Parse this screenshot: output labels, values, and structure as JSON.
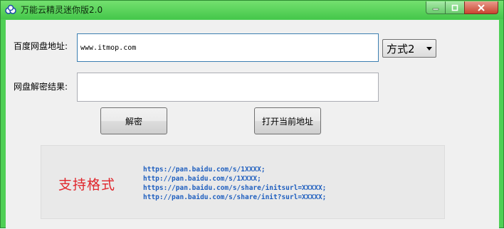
{
  "window": {
    "title": "万能云精灵迷你版2.0"
  },
  "form": {
    "pan_url_label": "百度网盘地址:",
    "pan_url_value": "www.itmop.com",
    "method_selected": "方式2",
    "result_label": "网盘解密结果:",
    "result_value": ""
  },
  "buttons": {
    "decrypt": "解密",
    "open_current": "打开当前地址"
  },
  "formats": {
    "title": "支持格式",
    "items": [
      "https://pan.baidu.com/s/1XXXX;",
      "http://pan.baidu.com/s/1XXXX;",
      "https://pan.baidu.com/s/share/initsurl=XXXXX;",
      "http://pan.baidu.com/s/share/init?surl=XXXXX;"
    ]
  },
  "colors": {
    "titlebar": "#4fcf55",
    "format_title": "#e0262c",
    "format_urls": "#1f5fbf"
  }
}
